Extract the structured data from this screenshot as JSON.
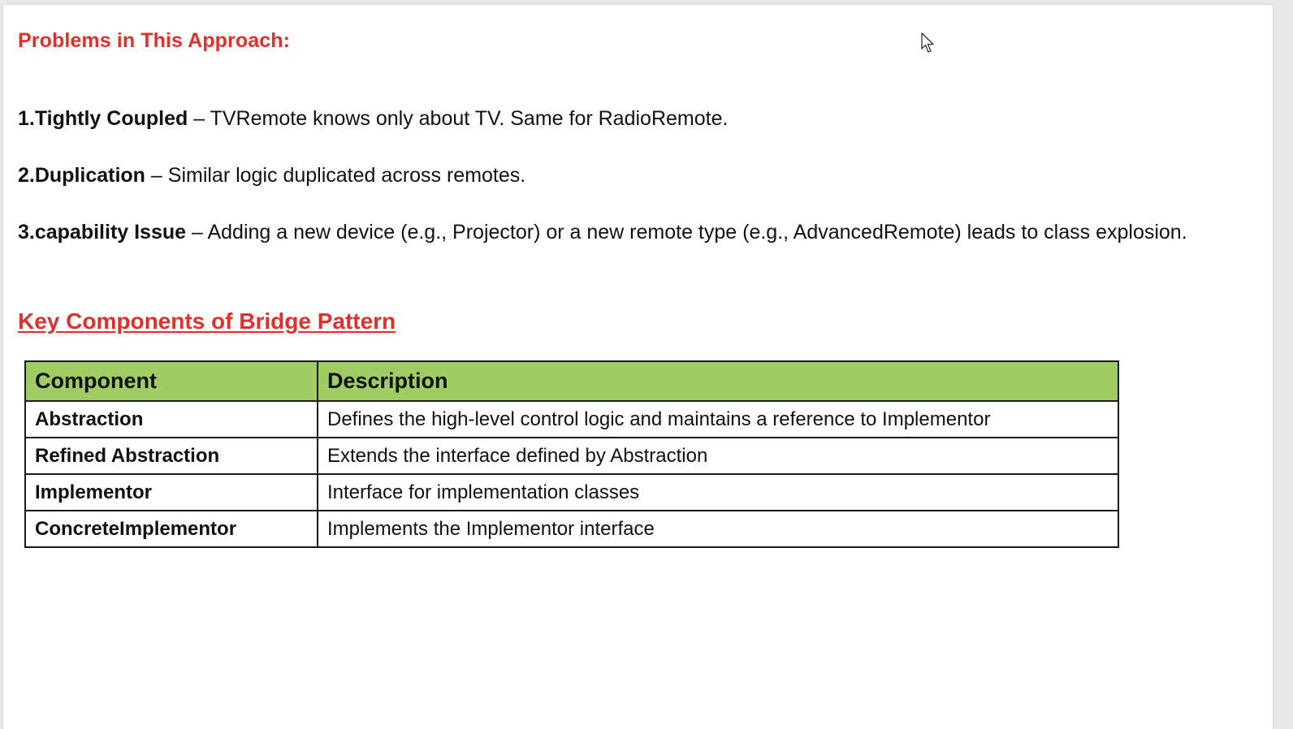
{
  "problems_heading": "Problems in This Approach:",
  "problems": [
    {
      "title": "1.Tightly Coupled",
      "text": " – TVRemote knows only about TV. Same for RadioRemote."
    },
    {
      "title": "2.Duplication",
      "text": " – Similar logic duplicated across remotes."
    },
    {
      "title": "3.capability Issue",
      "text": " – Adding a new device (e.g., Projector) or a new remote type (e.g., AdvancedRemote) leads to class explosion."
    }
  ],
  "section_title": "Key Components of Bridge Pattern",
  "table": {
    "headers": [
      "Component",
      "Description"
    ],
    "rows": [
      [
        "Abstraction",
        "Defines the high-level control logic and maintains a reference to Implementor"
      ],
      [
        "Refined Abstraction",
        "Extends the interface defined by Abstraction"
      ],
      [
        "Implementor",
        "Interface for implementation classes"
      ],
      [
        "ConcreteImplementor",
        "Implements the Implementor interface"
      ]
    ]
  },
  "colors": {
    "heading_red": "#e0302b",
    "table_header_green": "#9fcd63"
  },
  "icons": {
    "cursor": "mouse-pointer-icon"
  }
}
